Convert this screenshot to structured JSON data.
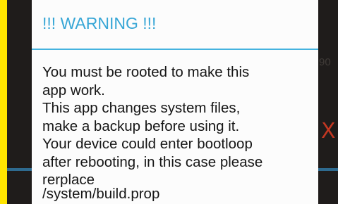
{
  "backdrop": {
    "side_number": "90",
    "close_glyph": "X"
  },
  "dialog": {
    "title": "!!! WARNING !!!",
    "message_lines": [
      "You must be rooted to make this",
      "app work.",
      "This app changes system files,",
      "make a backup before using it.",
      "Your device could enter bootloop",
      "after rebooting, in this case please",
      "rerplace",
      "/system/build.prop"
    ]
  },
  "colors": {
    "frame": "#ffe500",
    "backdrop": "#1f1c1b",
    "accent": "#37a6d6",
    "divider": "#45b3df",
    "close": "#c23722",
    "text": "#161616"
  }
}
